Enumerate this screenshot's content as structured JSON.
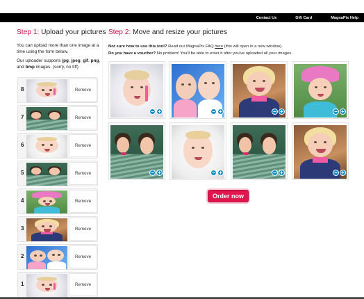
{
  "topnav": {
    "links": [
      "Contact Us",
      "Gift Card",
      "MagnaPix Help"
    ]
  },
  "step1": {
    "label": "Step 1:",
    "title": "Upload your pictures",
    "para1": "You can upload more than one image at a time using the form below.",
    "para2_prefix": "Our uploader supports ",
    "fmt1": "jpg",
    "sep1": ", ",
    "fmt2": "jpeg",
    "sep2": ", ",
    "fmt3": "gif",
    "sep3": ", ",
    "fmt4": "png",
    "sep4": ", and ",
    "fmt5": "bmp",
    "para2_suffix": " images. (sorry, no tiff)"
  },
  "uploads": [
    {
      "number": "8",
      "remove_label": "Remove",
      "thumb": "baby-bath"
    },
    {
      "number": "7",
      "remove_label": "Remove",
      "thumb": "kids-pool"
    },
    {
      "number": "6",
      "remove_label": "Remove",
      "thumb": "baby-face"
    },
    {
      "number": "5",
      "remove_label": "Remove",
      "thumb": "kids-pool"
    },
    {
      "number": "4",
      "remove_label": "Remove",
      "thumb": "girl-hat"
    },
    {
      "number": "3",
      "remove_label": "Remove",
      "thumb": "girl-laughing"
    },
    {
      "number": "2",
      "remove_label": "Remove",
      "thumb": "two-babies"
    },
    {
      "number": "1",
      "remove_label": "Remove",
      "thumb": "baby-bath"
    }
  ],
  "step2": {
    "label": "Step 2:",
    "title": "Move and resize your pictures",
    "help_bold": "Not sure how to use this tool?",
    "help_text1": " Read our MagnaPix FAQ ",
    "help_link": "here",
    "help_text2": " (this will open in a new window).",
    "voucher_bold": "Do you have a voucher?",
    "voucher_text": " No problem! You'll be able to enter it after you've uploaded all your images."
  },
  "grid": [
    {
      "photo": "baby-bath"
    },
    {
      "photo": "two-babies"
    },
    {
      "photo": "girl-laughing"
    },
    {
      "photo": "girl-hat"
    },
    {
      "photo": "kids-pool"
    },
    {
      "photo": "baby-face"
    },
    {
      "photo": "kids-pool"
    },
    {
      "photo": "girl-laughing"
    }
  ],
  "controls": {
    "minus": "−",
    "plus": "+"
  },
  "order_button": "Order now",
  "colors": {
    "accent": "#cc1046",
    "order_button": "#e0164f",
    "zoom_controls": "#1590c7",
    "topbar": "#000000"
  }
}
